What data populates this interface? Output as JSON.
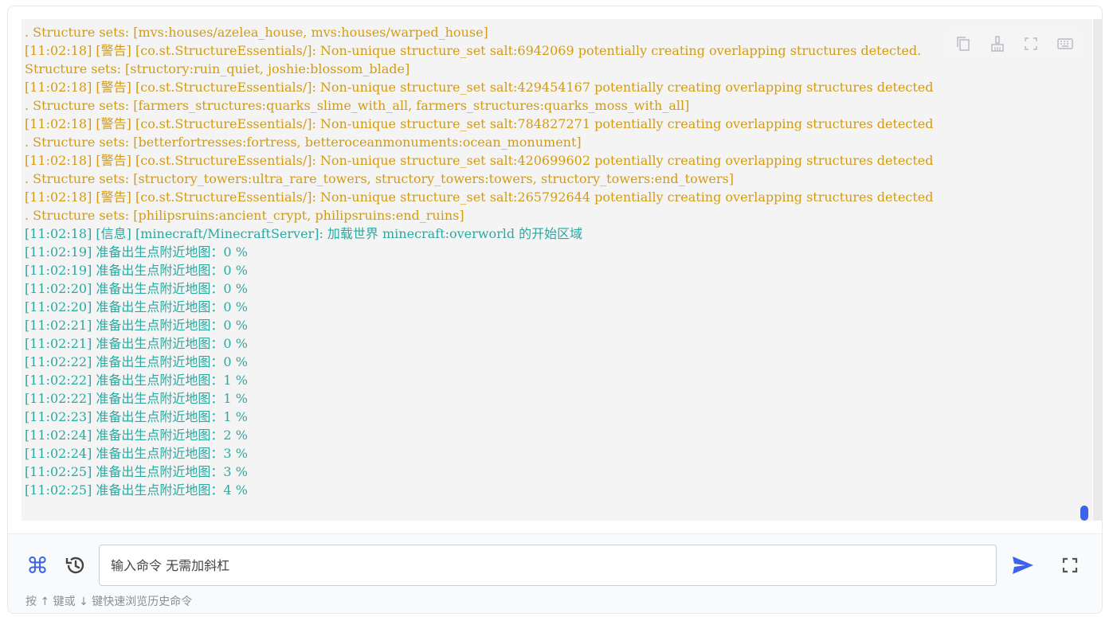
{
  "console": {
    "lines": [
      {
        "text": ". Structure sets: [mvs:houses/azelea_house, mvs:houses/warped_house]",
        "level": "warn"
      },
      {
        "text": "[11:02:18] [警告] [co.st.StructureEssentials/]: Non-unique structure_set salt:6942069 potentially creating overlapping structures detected.",
        "level": "warn"
      },
      {
        "text": "Structure sets: [structory:ruin_quiet, joshie:blossom_blade]",
        "level": "warn"
      },
      {
        "text": "[11:02:18] [警告] [co.st.StructureEssentials/]: Non-unique structure_set salt:429454167 potentially creating overlapping structures detected",
        "level": "warn"
      },
      {
        "text": ". Structure sets: [farmers_structures:quarks_slime_with_all, farmers_structures:quarks_moss_with_all]",
        "level": "warn"
      },
      {
        "text": "[11:02:18] [警告] [co.st.StructureEssentials/]: Non-unique structure_set salt:784827271 potentially creating overlapping structures detected",
        "level": "warn"
      },
      {
        "text": ". Structure sets: [betterfortresses:fortress, betteroceanmonuments:ocean_monument]",
        "level": "warn"
      },
      {
        "text": "[11:02:18] [警告] [co.st.StructureEssentials/]: Non-unique structure_set salt:420699602 potentially creating overlapping structures detected",
        "level": "warn"
      },
      {
        "text": ". Structure sets: [structory_towers:ultra_rare_towers, structory_towers:towers, structory_towers:end_towers]",
        "level": "warn"
      },
      {
        "text": "[11:02:18] [警告] [co.st.StructureEssentials/]: Non-unique structure_set salt:265792644 potentially creating overlapping structures detected",
        "level": "warn"
      },
      {
        "text": ". Structure sets: [philipsruins:ancient_crypt, philipsruins:end_ruins]",
        "level": "warn"
      },
      {
        "text": "[11:02:18] [信息] [minecraft/MinecraftServer]: 加载世界 minecraft:overworld 的开始区域",
        "level": "info"
      },
      {
        "text": "[11:02:19] 准备出生点附近地图：0 %",
        "level": "info"
      },
      {
        "text": "[11:02:19] 准备出生点附近地图：0 %",
        "level": "info"
      },
      {
        "text": "[11:02:20] 准备出生点附近地图：0 %",
        "level": "info"
      },
      {
        "text": "[11:02:20] 准备出生点附近地图：0 %",
        "level": "info"
      },
      {
        "text": "[11:02:21] 准备出生点附近地图：0 %",
        "level": "info"
      },
      {
        "text": "[11:02:21] 准备出生点附近地图：0 %",
        "level": "info"
      },
      {
        "text": "[11:02:22] 准备出生点附近地图：0 %",
        "level": "info"
      },
      {
        "text": "[11:02:22] 准备出生点附近地图：1 %",
        "level": "info"
      },
      {
        "text": "[11:02:22] 准备出生点附近地图：1 %",
        "level": "info"
      },
      {
        "text": "[11:02:23] 准备出生点附近地图：1 %",
        "level": "info"
      },
      {
        "text": "[11:02:24] 准备出生点附近地图：2 %",
        "level": "info"
      },
      {
        "text": "[11:02:24] 准备出生点附近地图：3 %",
        "level": "info"
      },
      {
        "text": "[11:02:25] 准备出生点附近地图：3 %",
        "level": "info"
      },
      {
        "text": "[11:02:25] 准备出生点附近地图：4 %",
        "level": "info"
      }
    ],
    "toolbar_icons": [
      "copy-icon",
      "clear-icon",
      "expand-icon",
      "keyboard-icon"
    ]
  },
  "command": {
    "placeholder": "输入命令 无需加斜杠",
    "value": "",
    "hint": "按 ↑ 键或 ↓ 键快速浏览历史命令",
    "icons": {
      "shortcut": "command-key-icon",
      "history": "history-icon",
      "send": "send-icon",
      "fullscreen": "fullscreen-icon"
    }
  },
  "colors": {
    "warn": "#d49b12",
    "info": "#2aa9a0",
    "accent": "#3d63ea"
  }
}
